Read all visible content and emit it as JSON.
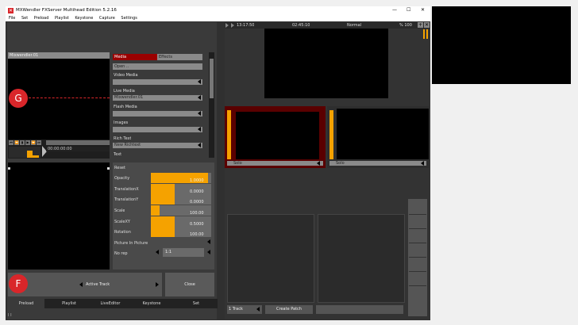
{
  "window": {
    "title": "MXWendler FXServer Multihead Edition 5.2.16",
    "controls": [
      "—",
      "☐",
      "✕"
    ]
  },
  "menu": [
    "File",
    "Set",
    "Preload",
    "Playlist",
    "Keystone",
    "Capture",
    "Settings"
  ],
  "preview": {
    "label": "Mixwendler.01",
    "timecode": "00:00:00:00"
  },
  "transport_buttons": [
    "⏮",
    "⏪",
    "▮",
    "▶",
    "⏩",
    "⏭"
  ],
  "media_panel": {
    "tab_media": "Media",
    "tab_effects": "Effects",
    "open_label": "Open ..",
    "items": [
      {
        "label": "Video Media",
        "value": ""
      },
      {
        "label": "Live Media",
        "value": "Mixwendler.01"
      },
      {
        "label": "Flash Media",
        "value": ""
      },
      {
        "label": "Images",
        "value": ""
      },
      {
        "label": "Rich Text",
        "value": "New Richtext"
      },
      {
        "label": "Text",
        "value": ""
      }
    ]
  },
  "params": {
    "reset_label": "Reset",
    "rows": [
      {
        "label": "Opacity",
        "value": "1.0000",
        "level": 0.95
      },
      {
        "label": "TranslationX",
        "value": "0.0000",
        "level": 0.4
      },
      {
        "label": "TranslationY",
        "value": "0.0000",
        "level": 0.4
      },
      {
        "label": "Scale",
        "value": "100.00",
        "level": 0.15
      },
      {
        "label": "ScaleXY",
        "value": "0.5000",
        "level": 0.4
      },
      {
        "label": "Rotation",
        "value": "100.00",
        "level": 0.4
      }
    ],
    "pip_label": "Picture In Picture",
    "norep_label": "No rep",
    "norep_value": "1:1"
  },
  "bottom": {
    "active_track": "Active Track",
    "close": "Close"
  },
  "tabs": [
    "Preload",
    "Playlist",
    "LiveEditor",
    "Keystone",
    "Set"
  ],
  "status": "I I",
  "output": {
    "time_left": "13:17:50",
    "time_mid": "02:45:10",
    "mode": "Normal",
    "percent": "% 100"
  },
  "slots": [
    {
      "label": "Solo"
    },
    {
      "label": "Solo"
    }
  ],
  "lower": {
    "track": "1 Track",
    "create_patch": "Create Patch"
  },
  "callouts": {
    "g": "G",
    "f": "F"
  },
  "colors": {
    "accent": "#f5a200",
    "selected": "#9a0000",
    "panel": "#303030"
  }
}
